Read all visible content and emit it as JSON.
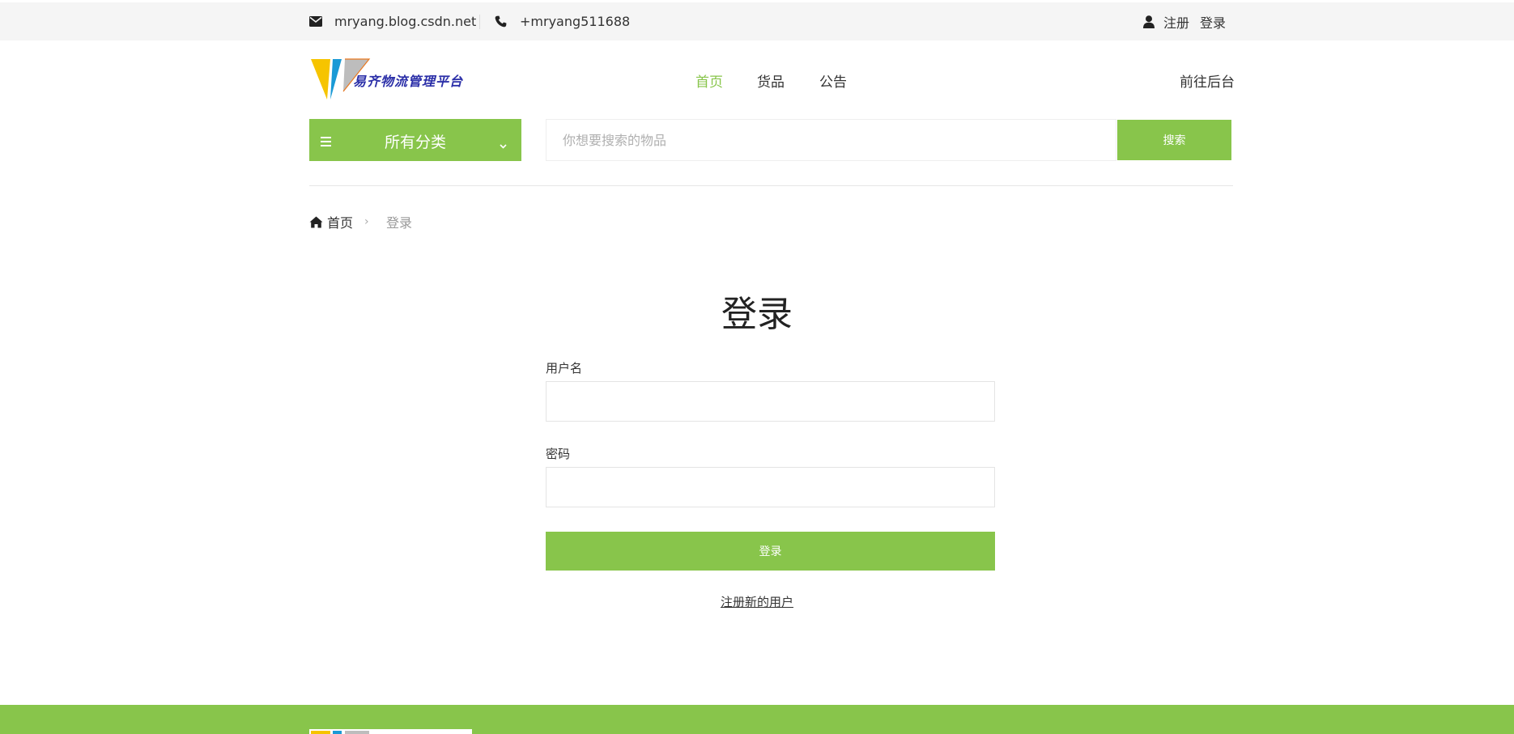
{
  "topbar": {
    "email": "mryang.blog.csdn.net",
    "phone": "+mryang511688",
    "register": "注册",
    "login": "登录"
  },
  "logo": {
    "text": "易齐物流管理平台"
  },
  "nav": {
    "items": [
      "首页",
      "货品",
      "公告"
    ],
    "admin": "前往后台"
  },
  "category": {
    "label": "所有分类"
  },
  "search": {
    "placeholder": "你想要搜索的物品",
    "button": "搜索"
  },
  "breadcrumb": {
    "home": "首页",
    "separator": "›",
    "current": "登录"
  },
  "form": {
    "title": "登录",
    "username_label": "用户名",
    "password_label": "密码",
    "submit": "登录",
    "register_link": "注册新的用户"
  },
  "colors": {
    "accent": "#88c54b",
    "topbar_bg": "#f5f5f5",
    "logo_text": "#2b2fa8"
  },
  "icons": [
    "envelope-icon",
    "phone-icon",
    "user-icon",
    "menu-icon",
    "chevron-down-icon",
    "home-icon"
  ]
}
